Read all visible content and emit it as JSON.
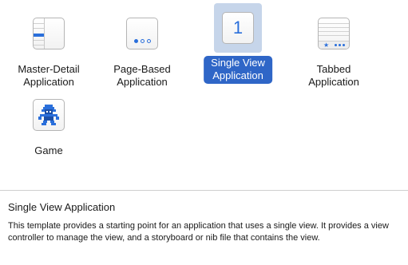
{
  "templates": [
    {
      "label_line1": "Master-Detail",
      "label_line2": "Application",
      "icon": "master-detail-icon"
    },
    {
      "label_line1": "Page-Based",
      "label_line2": "Application",
      "icon": "page-based-icon"
    },
    {
      "label_line1": "Single View",
      "label_line2": "Application",
      "icon": "single-view-icon",
      "icon_text": "1",
      "selected": true
    },
    {
      "label_line1": "Tabbed",
      "label_line2": "Application",
      "icon": "tabbed-icon"
    },
    {
      "label_line1": "Game",
      "label_line2": "",
      "icon": "game-icon"
    }
  ],
  "description": {
    "title": "Single View Application",
    "body": "This template provides a starting point for an application that uses a single view. It provides a view controller to manage the view, and a storyboard or nib file that contains the view."
  },
  "colors": {
    "accent": "#2a6fdb",
    "selection_label_bg": "#2f66c7",
    "selection_tile_bg": "#c6d5ea"
  }
}
